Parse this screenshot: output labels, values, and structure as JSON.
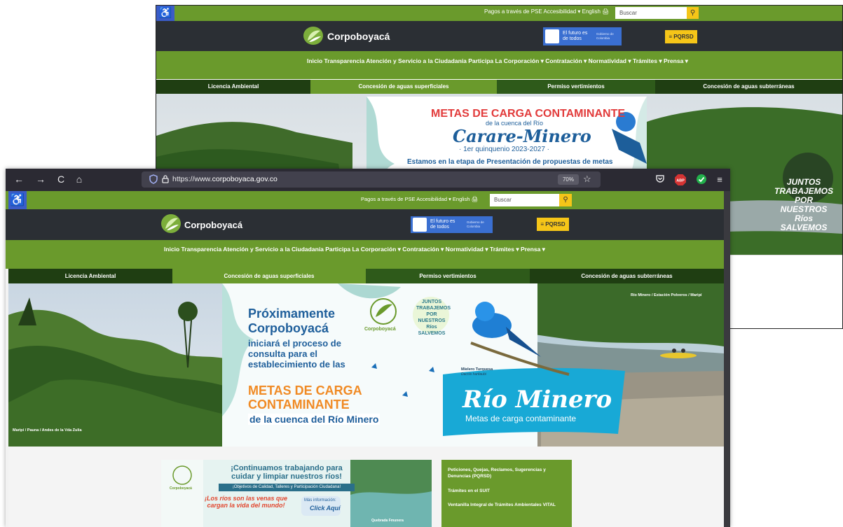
{
  "site": {
    "logo_text": "Corpoboyacá",
    "gov": {
      "line1": "El futuro es de todos",
      "line2": "Gobierno de Colombia"
    },
    "pqrsd": "≡ PQRSD",
    "toplinks": "Pagos a través de PSE   Accesibilidad ▾   English   🖨",
    "search_placeholder": "Buscar",
    "nav_items": "Inicio   Transparencia   Atención y Servicio a la Ciudadanía   Participa   La Corporación ▾   Contratación ▾   Normatividad ▾   Trámites ▾   Prensa ▾",
    "tabs": [
      "Licencia Ambiental",
      "Concesión de aguas superficiales",
      "Permiso vertimientos",
      "Concesión de aguas subterráneas"
    ]
  },
  "back_banner": {
    "title1": "METAS DE CARGA CONTAMINANTE",
    "title2": "de la cuenca del Río",
    "title3": "Carare-Minero",
    "title4": "· 1er quinquenio 2023-2027 ·",
    "title5": "Estamos en la etapa de Presentación de propuestas de metas",
    "side_logo": "JUNTOS TRABAJEMOS POR NUESTROS Ríos SALVEMOS"
  },
  "browser": {
    "url_scheme": "https://www.",
    "url_host": "corpoboyaca.gov.co",
    "zoom": "70%",
    "icons": {
      "back": "←",
      "forward": "→",
      "reload": "C",
      "home": "⌂",
      "shield": "🛡",
      "lock": "🔒",
      "star": "☆",
      "pocket": "♥",
      "abp": "ABP",
      "check": "✓",
      "menu": "≡"
    }
  },
  "front_banner": {
    "label_top_right": "Río Minero / Estación Polveros / Maripí",
    "label_bottom_left": "Maripí / Pauna / Andes de la Vda Zulia",
    "lead": "Próximamente Corpoboyacá",
    "body": "iniciará el proceso de consulta para el establecimiento de las",
    "metas1": "METAS DE CARGA",
    "metas2": "CONTAMINANTE",
    "cuenca": "de la cuenca del Río Minero",
    "bird_caption1": "Mielero Turquesa",
    "bird_caption2": "Dacnis hartlaubi",
    "rio": "Río Minero",
    "rio_sub": "Metas de carga contaminante",
    "logo_small": "Corpoboyacá",
    "juntos": "JUNTOS TRABAJEMOS POR NUESTROS Ríos SALVEMOS"
  },
  "promo": {
    "title": "¡Continuamos trabajando para cuidar y limpiar nuestros ríos!",
    "objetivos": "¡Objetivos de Calidad, Talleres y Participación Ciudadana!",
    "venas": "¡Los ríos son las venas que cargan la vida del mundo!",
    "mas": "Más información:",
    "click": "Click Aquí",
    "quebrada": "Quebrada Fmunera",
    "logo": "Corpoboyacá"
  },
  "sidebox": {
    "items": [
      "Peticiones, Quejas, Reclamos, Sugerencias y Denuncias (PQRSD)",
      "Trámites en el SUIT",
      "Ventanilla Integral de Trámites Ambientales VITAL"
    ]
  },
  "colors": {
    "green": "#6a9a2c",
    "dark": "#2b2f34",
    "yellow": "#f5c518",
    "gov_blue": "#3a6fd1",
    "access_blue": "#3b5cc7",
    "tab_dark": "#1f3e12",
    "orange": "#f08a24",
    "teal_title": "#1d5e9a"
  }
}
